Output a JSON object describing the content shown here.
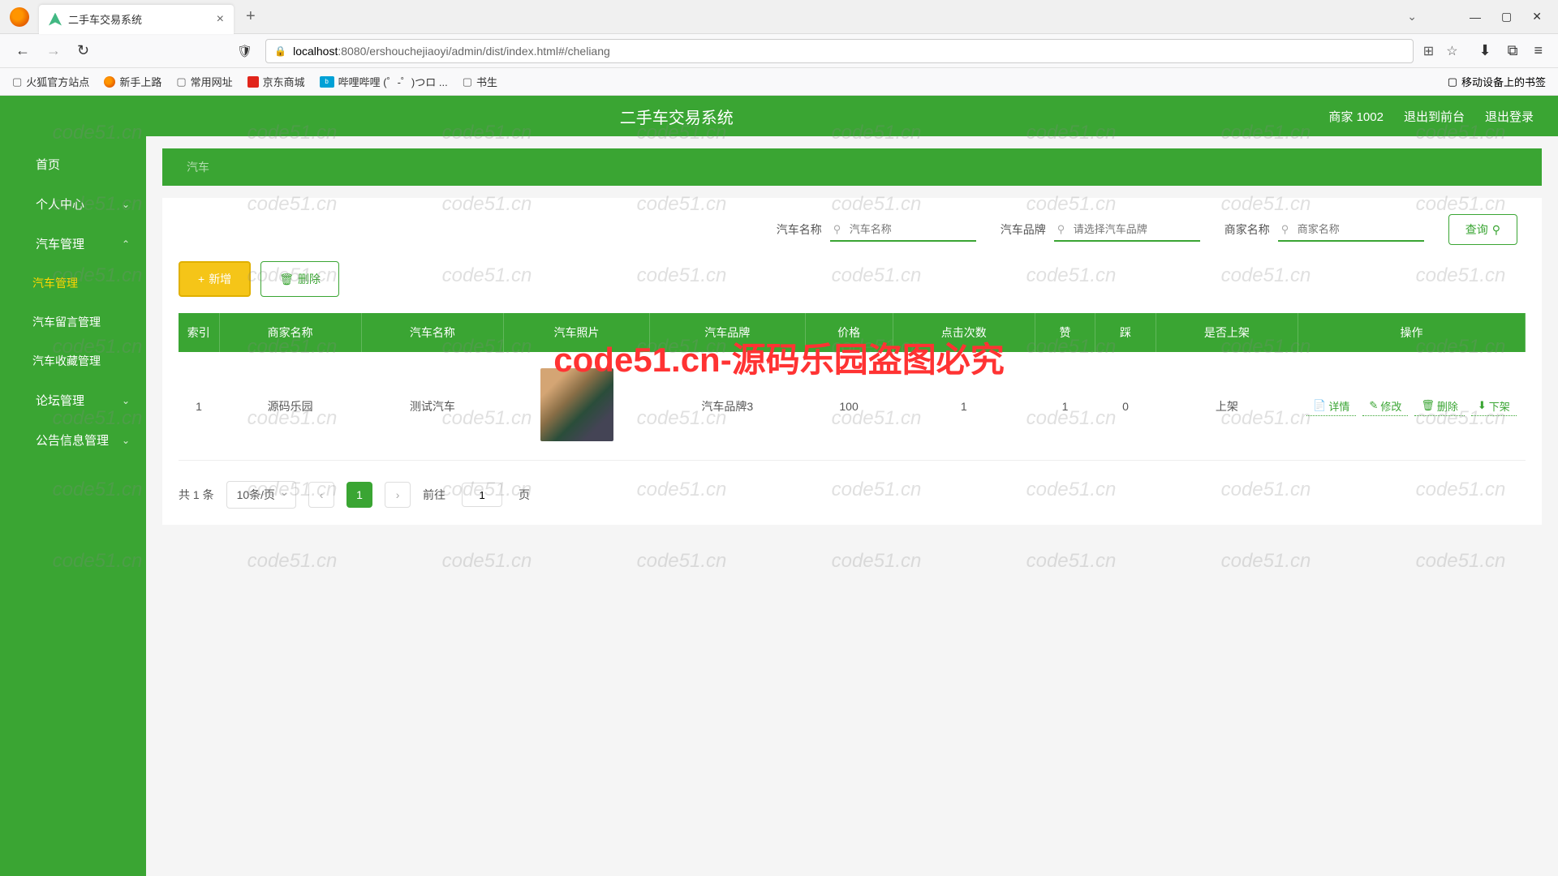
{
  "browser": {
    "tab_title": "二手车交易系统",
    "url_prefix": "localhost",
    "url_path": ":8080/ershouchejiaoyi/admin/dist/index.html#/cheliang",
    "bookmarks": [
      "火狐官方站点",
      "新手上路",
      "常用网址",
      "京东商城",
      "哔哩哔哩 (゜-゜)つロ ...",
      "书生"
    ],
    "bookmark_right": "移动设备上的书签"
  },
  "header": {
    "title": "二手车交易系统",
    "user": "商家 1002",
    "link_front": "退出到前台",
    "link_logout": "退出登录"
  },
  "sidebar": {
    "home": "首页",
    "items": [
      {
        "label": "个人中心",
        "expanded": false
      },
      {
        "label": "汽车管理",
        "expanded": true,
        "children": [
          {
            "label": "汽车管理",
            "active": true
          },
          {
            "label": "汽车留言管理"
          },
          {
            "label": "汽车收藏管理"
          }
        ]
      },
      {
        "label": "论坛管理",
        "expanded": false
      },
      {
        "label": "公告信息管理",
        "expanded": false
      }
    ]
  },
  "breadcrumb": "汽车",
  "search": {
    "fields": [
      {
        "label": "汽车名称",
        "placeholder": "汽车名称"
      },
      {
        "label": "汽车品牌",
        "placeholder": "请选择汽车品牌"
      },
      {
        "label": "商家名称",
        "placeholder": "商家名称"
      }
    ],
    "query_btn": "查询"
  },
  "action_buttons": {
    "add": "新增",
    "delete": "删除"
  },
  "table": {
    "headers": [
      "索引",
      "商家名称",
      "汽车名称",
      "汽车照片",
      "汽车品牌",
      "价格",
      "点击次数",
      "赞",
      "踩",
      "是否上架",
      "操作"
    ],
    "rows": [
      {
        "idx": "1",
        "merchant": "源码乐园",
        "car_name": "测试汽车",
        "brand": "汽车品牌3",
        "price": "100",
        "clicks": "1",
        "likes": "1",
        "dislikes": "0",
        "status": "上架"
      }
    ],
    "row_actions": {
      "detail": "详情",
      "edit": "修改",
      "delete": "删除",
      "offshelf": "下架"
    }
  },
  "pagination": {
    "total": "共 1 条",
    "page_size": "10条/页",
    "current": "1",
    "goto_prefix": "前往",
    "goto_value": "1",
    "goto_suffix": "页"
  },
  "watermark": {
    "main": "code51.cn-源码乐园盗图必究",
    "bg": "code51.cn"
  }
}
